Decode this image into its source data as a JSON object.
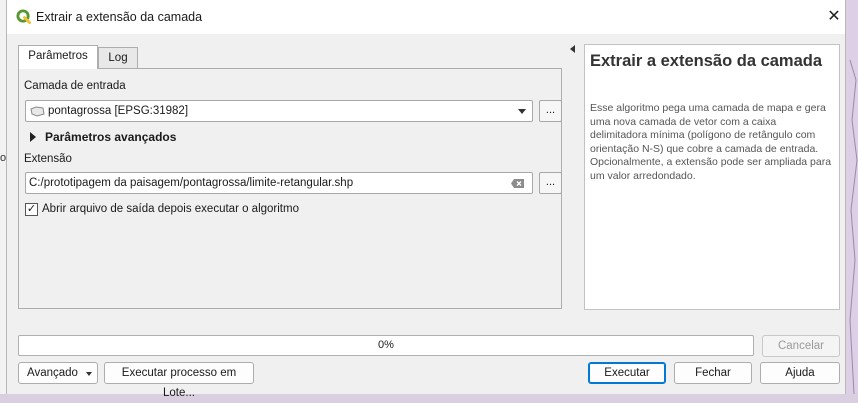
{
  "background": {
    "left_partial_label": "os"
  },
  "dialog": {
    "title": "Extrair a extensão da camada",
    "close_symbol": "✕"
  },
  "tabs": [
    {
      "label": "Parâmetros",
      "active": true
    },
    {
      "label": "Log",
      "active": false
    }
  ],
  "params": {
    "input_layer_label": "Camada de entrada",
    "input_layer_value": "pontagrossa [EPSG:31982]",
    "input_layer_icon": "polygon-layer-icon",
    "browse_label": "...",
    "advanced_label": "Parâmetros avançados",
    "extent_label": "Extensão",
    "extent_value": "C:/prototipagem da paisagem/pontagrossa/limite-retangular.shp",
    "extent_browse_label": "...",
    "open_output_label": "Abrir arquivo de saída depois executar o algoritmo",
    "open_output_checked": true,
    "check_mark": "✓"
  },
  "help": {
    "title": "Extrair a extensão da camada",
    "body": "Esse algoritmo pega uma camada de mapa e gera uma nova camada de vetor com a caixa delimitadora mínima (polígono de retângulo com orientação N-S) que cobre a camada de entrada. Opcionalmente, a extensão pode ser ampliada para um valor arredondado."
  },
  "progress": {
    "value": 0,
    "text": "0%",
    "cancel_label": "Cancelar"
  },
  "footer": {
    "advanced_label": "Avançado",
    "batch_label": "Executar processo em Lote...",
    "run_label": "Executar",
    "close_label": "Fechar",
    "help_label": "Ajuda"
  },
  "colors": {
    "accent": "#0078d4",
    "qgis_green": "#589632",
    "qgis_yellow": "#f0c330"
  }
}
